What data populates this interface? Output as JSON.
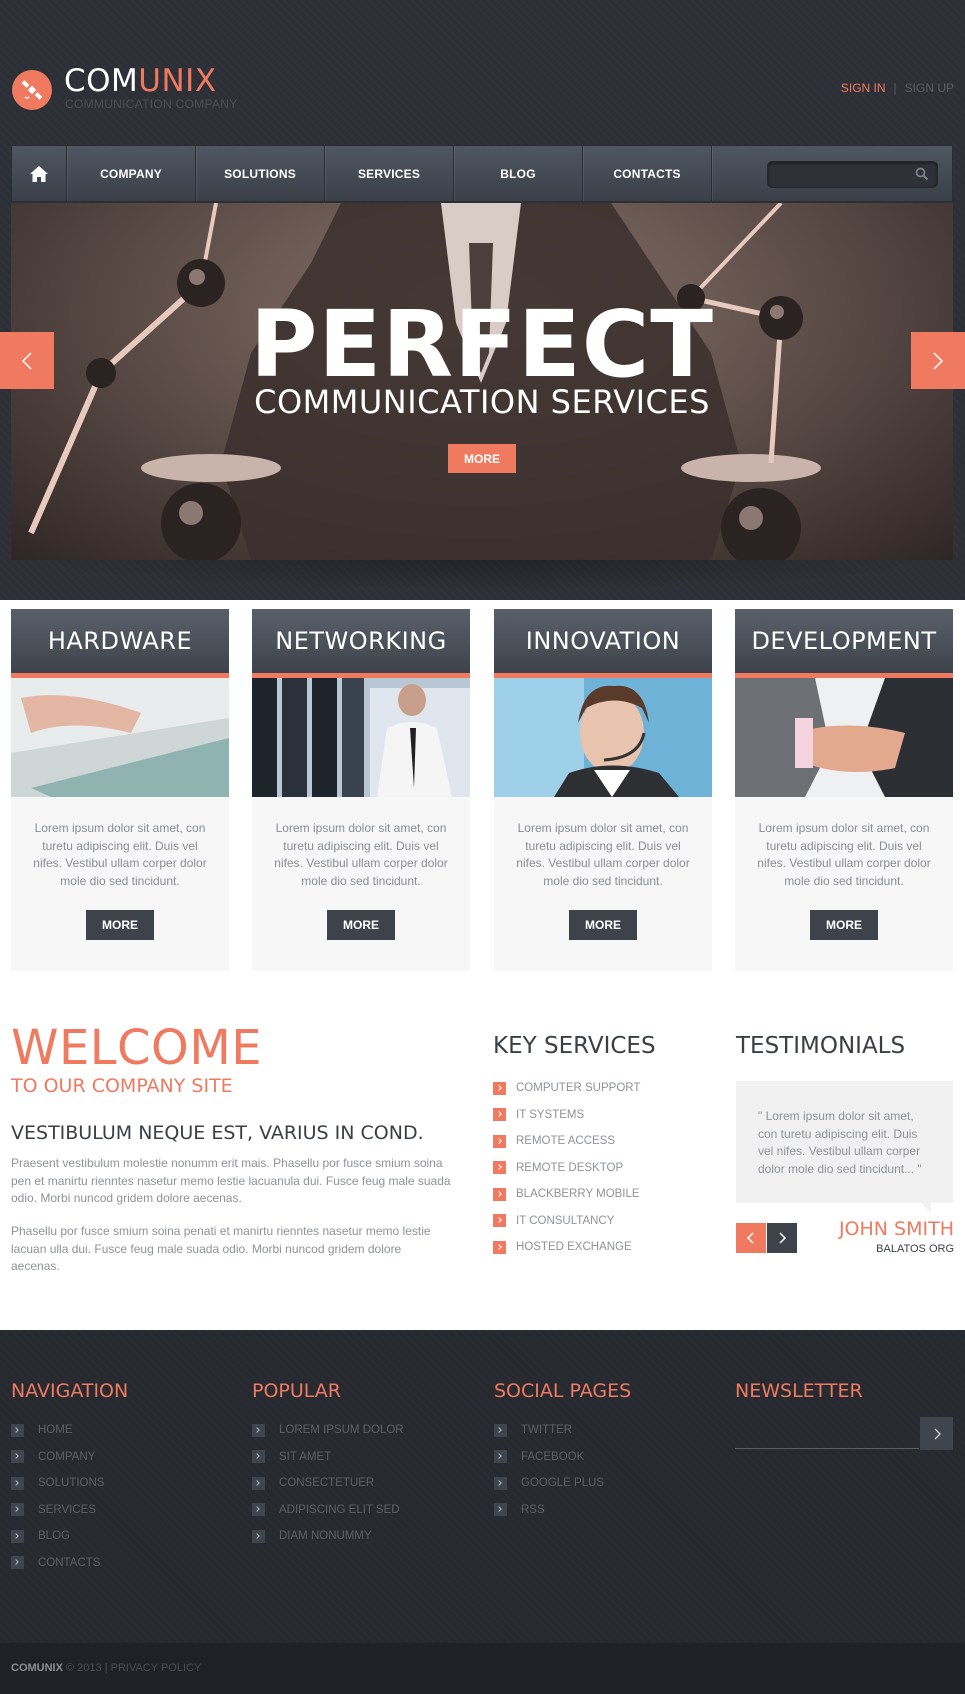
{
  "header": {
    "brand_part1": "COM",
    "brand_part2": "UNIX",
    "tagline": "COMMUNICATION COMPANY",
    "sign_in": "SIGN IN",
    "separator": "|",
    "sign_up": "SIGN UP",
    "logo_icon": "satellite-icon"
  },
  "nav": {
    "home_icon": "home-icon",
    "items": [
      "COMPANY",
      "SOLUTIONS",
      "SERVICES",
      "BLOG",
      "CONTACTS"
    ],
    "search_placeholder": ""
  },
  "hero": {
    "title": "PERFECT",
    "subtitle": "COMMUNICATION SERVICES",
    "button": "MORE"
  },
  "features": [
    {
      "title": "HARDWARE",
      "text": "Lorem ipsum dolor sit amet, con turetu adipiscing elit. Duis vel nifes. Vestibul ullam corper dolor mole dio sed tincidunt.",
      "button": "MORE"
    },
    {
      "title": "NETWORKING",
      "text": "Lorem ipsum dolor sit amet, con turetu adipiscing elit. Duis vel nifes. Vestibul ullam corper dolor mole dio sed tincidunt.",
      "button": "MORE"
    },
    {
      "title": "INNOVATION",
      "text": "Lorem ipsum dolor sit amet, con turetu adipiscing elit. Duis vel nifes. Vestibul ullam corper dolor mole dio sed tincidunt.",
      "button": "MORE"
    },
    {
      "title": "DEVELOPMENT",
      "text": "Lorem ipsum dolor sit amet, con turetu adipiscing elit. Duis vel nifes. Vestibul ullam corper dolor mole dio sed tincidunt.",
      "button": "MORE"
    }
  ],
  "welcome": {
    "title": "WELCOME",
    "subtitle": "TO OUR COMPANY SITE",
    "heading": "VESTIBULUM NEQUE EST, VARIUS IN COND.",
    "p1": "Praesent vestibulum molestie nonumm erit mais. Phasellu por fusce smium soina pen et manirtu rienntes nasetur memo lestie lacuanula dui. Fusce feug male suada odio. Morbi nuncod gridem dolore aecenas.",
    "p2": "Phasellu por fusce smium soina penati et manirtu rienntes nasetur memo lestie lacuan ulla dui. Fusce feug male suada odio. Morbi nuncod gridem dolore aecenas."
  },
  "key_services": {
    "title": "KEY SERVICES",
    "items": [
      "COMPUTER SUPPORT",
      "IT SYSTEMS",
      "REMOTE ACCESS",
      "REMOTE DESKTOP",
      "BLACKBERRY MOBILE",
      "IT CONSULTANCY",
      "HOSTED EXCHANGE"
    ]
  },
  "testimonials": {
    "title": "TESTIMONIALS",
    "quote": "\" Lorem ipsum dolor sit amet, con turetu adipiscing elit. Duis vel nifes. Vestibul ullam corper dolor mole dio sed tincidunt... \"",
    "name": "JOHN SMITH",
    "org": "BALATOS ORG"
  },
  "footer": {
    "navigation": {
      "title": "NAVIGATION",
      "items": [
        "HOME",
        "COMPANY",
        "SOLUTIONS",
        "SERVICES",
        "BLOG",
        "CONTACTS"
      ]
    },
    "popular": {
      "title": "POPULAR",
      "items": [
        "LOREM IPSUM DOLOR",
        "SIT AMET",
        "CONSECTETUER",
        "ADIPISCING ELIT SED",
        "DIAM NONUMMY"
      ]
    },
    "social": {
      "title": "SOCIAL PAGES",
      "items": [
        "TWITTER",
        "FACEBOOK",
        "GOOGLE PLUS",
        "RSS"
      ]
    },
    "newsletter": {
      "title": "NEWSLETTER",
      "placeholder": ""
    },
    "copyright_brand": "COMUNIX",
    "copyright_rest": "© 2013 | PRIVACY POLICY"
  },
  "colors": {
    "accent": "#ef7a5f",
    "dark": "#2c2f35",
    "nav": "#464b54"
  }
}
